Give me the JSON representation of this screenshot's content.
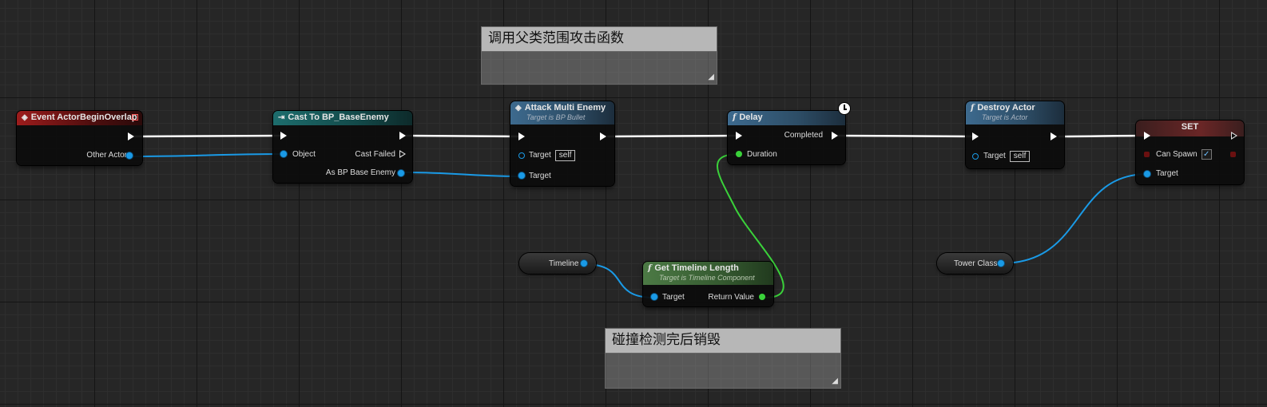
{
  "comments": [
    {
      "title": "调用父类范围攻击函数"
    },
    {
      "title": "碰撞检测完后销毁"
    }
  ],
  "nodes": {
    "event": {
      "title": "Event ActorBeginOverlap",
      "out_pin": "Other Actor"
    },
    "cast": {
      "title": "Cast To BP_BaseEnemy",
      "object_pin": "Object",
      "cast_failed": "Cast Failed",
      "as_pin": "As BP Base Enemy"
    },
    "attack": {
      "title": "Attack Multi Enemy",
      "subtitle": "Target is BP Bullet",
      "target_pin": "Target",
      "target_default": "self",
      "target2_pin": "Target"
    },
    "delay": {
      "title": "Delay",
      "completed_pin": "Completed",
      "duration_pin": "Duration"
    },
    "destroy": {
      "title": "Destroy Actor",
      "subtitle": "Target is Actor",
      "target_pin": "Target",
      "target_default": "self"
    },
    "set": {
      "title": "SET",
      "can_spawn_pin": "Can Spawn",
      "target_pin": "Target"
    },
    "get_timeline": {
      "title": "Get Timeline Length",
      "subtitle": "Target is Timeline Component",
      "target_pin": "Target",
      "return_pin": "Return Value"
    },
    "timeline_var": {
      "label": "Timeline"
    },
    "tower_var": {
      "label": "Tower Class"
    }
  },
  "icons": {
    "event": "event-diamond-icon",
    "cast": "cast-arrow-icon",
    "function": "function-f-icon",
    "latent": "clock-icon"
  },
  "colors": {
    "exec_wire": "#ffffff",
    "object_wire": "#1a9ae6",
    "float_wire": "#3ad23a",
    "event_header": "#9c1c1c",
    "cast_header": "#1d6d6d",
    "function_header": "#3d6a8e",
    "pure_header": "#4c7a45"
  }
}
